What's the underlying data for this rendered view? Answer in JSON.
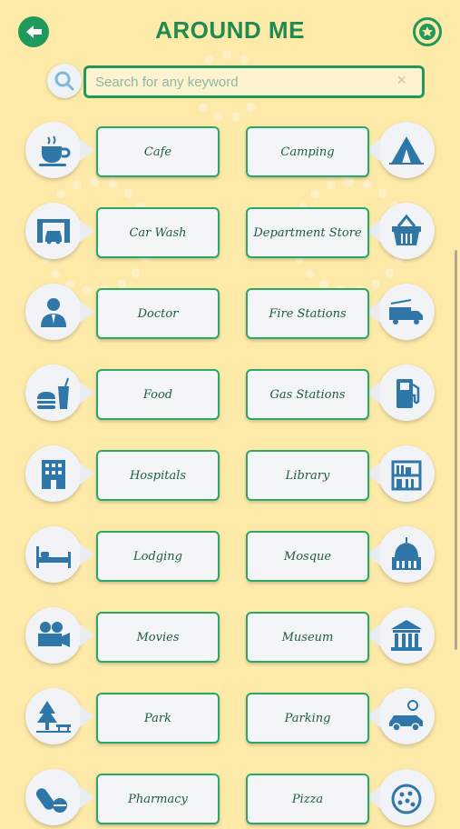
{
  "header": {
    "title": "AROUND ME",
    "back_icon": "back-arrow-icon",
    "favorite_icon": "star-badge-icon"
  },
  "search": {
    "placeholder": "Search for any keyword",
    "value": "",
    "search_icon": "magnifier-icon",
    "clear_icon": "clear-x-icon",
    "clear_label": "×"
  },
  "colors": {
    "accent": "#1f9a5c",
    "background": "#fde9a8",
    "label_text": "#1f5c3e",
    "icon_blue": "#2f77a8"
  },
  "categories": [
    {
      "label": "Cafe",
      "icon": "coffee-cup-icon"
    },
    {
      "label": "Camping",
      "icon": "tent-icon"
    },
    {
      "label": "Car Wash",
      "icon": "car-wash-icon"
    },
    {
      "label": "Department Store",
      "icon": "shopping-basket-icon"
    },
    {
      "label": "Doctor",
      "icon": "doctor-icon"
    },
    {
      "label": "Fire Stations",
      "icon": "fire-truck-icon"
    },
    {
      "label": "Food",
      "icon": "burger-drink-icon"
    },
    {
      "label": "Gas Stations",
      "icon": "fuel-pump-icon"
    },
    {
      "label": "Hospitals",
      "icon": "hospital-building-icon"
    },
    {
      "label": "Library",
      "icon": "bookshelf-icon"
    },
    {
      "label": "Lodging",
      "icon": "bed-icon"
    },
    {
      "label": "Mosque",
      "icon": "mosque-dome-icon"
    },
    {
      "label": "Movies",
      "icon": "film-camera-icon"
    },
    {
      "label": "Museum",
      "icon": "museum-icon"
    },
    {
      "label": "Park",
      "icon": "tree-bench-icon"
    },
    {
      "label": "Parking",
      "icon": "parking-car-icon"
    },
    {
      "label": "Pharmacy",
      "icon": "pill-icon"
    },
    {
      "label": "Pizza",
      "icon": "pizza-icon"
    }
  ]
}
